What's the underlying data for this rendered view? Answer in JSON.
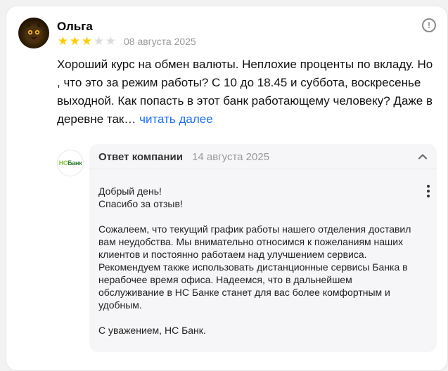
{
  "review": {
    "author": "Ольга",
    "rating": 3,
    "rating_max": 5,
    "date": "08 августа 2025",
    "text": "Хороший курс на обмен валюты. Неплохие проценты по вкладу. Но , что это за режим работы? С 10 до 18.45 и суббота, воскресенье выходной. Как попасть в этот банк работающему человеку? Даже в деревне так…",
    "read_more": "читать далее"
  },
  "reply": {
    "title": "Ответ компании",
    "date": "14 августа 2025",
    "logo_text_1": "НС",
    "logo_text_2": "Банк",
    "greeting_1": "Добрый день!",
    "greeting_2": "Спасибо за отзыв!",
    "body": "Сожалеем, что текущий график работы нашего отделения доставил вам неудобства. Мы внимательно относимся к пожеланиям наших клиентов и постоянно работаем над улучшением сервиса. Рекомендуем также использовать дистанционные сервисы Банка в нерабочее время офиса. Надеемся, что в дальнейшем обслуживание в НС Банке станет для вас более комфортным и удобным.",
    "signature": "С уважением, НС Банк."
  },
  "icons": {
    "info": "info-icon",
    "collapse": "chevron-up-icon",
    "more": "more-vertical-icon",
    "star": "star-icon"
  },
  "colors": {
    "star_filled": "#ffcc00",
    "star_empty": "#dcdcdc",
    "link": "#1b6ff5",
    "reply_bg": "#f6f6f8"
  }
}
